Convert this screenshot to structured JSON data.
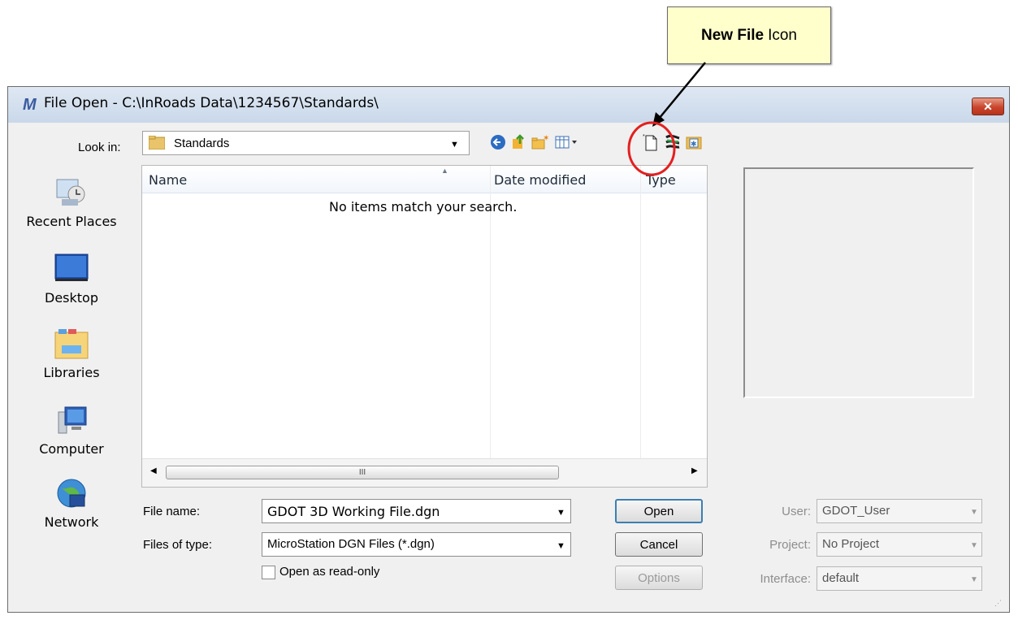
{
  "callout": {
    "bold": "New File",
    "rest": "Icon"
  },
  "dialog": {
    "title": "File Open - C:\\InRoads Data\\1234567\\Standards\\",
    "close_glyph": "✕",
    "look_in": {
      "label": "Look in:",
      "value": "Standards"
    },
    "places": [
      {
        "label": "Recent Places",
        "icon": "recent-places-icon"
      },
      {
        "label": "Desktop",
        "icon": "desktop-icon"
      },
      {
        "label": "Libraries",
        "icon": "libraries-icon"
      },
      {
        "label": "Computer",
        "icon": "computer-icon"
      },
      {
        "label": "Network",
        "icon": "network-icon"
      }
    ],
    "list": {
      "columns": [
        "Name",
        "Date modified",
        "Type"
      ],
      "empty_message": "No items match your search.",
      "scroll_thumb": "III"
    },
    "file_name": {
      "label": "File name:",
      "value": "GDOT 3D Working File.dgn"
    },
    "files_of_type": {
      "label": "Files of type:",
      "value": "MicroStation DGN Files (*.dgn)"
    },
    "readonly": {
      "label": "Open as read-only",
      "checked": false
    },
    "buttons": {
      "open": "Open",
      "cancel": "Cancel",
      "options": "Options"
    },
    "user": {
      "label": "User:",
      "value": "GDOT_User"
    },
    "project": {
      "label": "Project:",
      "value": "No Project"
    },
    "interface": {
      "label": "Interface:",
      "value": "default"
    }
  },
  "colors": {
    "callout_bg": "#ffffcc",
    "highlight_circle": "#e32020",
    "close_red": "#c8452c"
  }
}
